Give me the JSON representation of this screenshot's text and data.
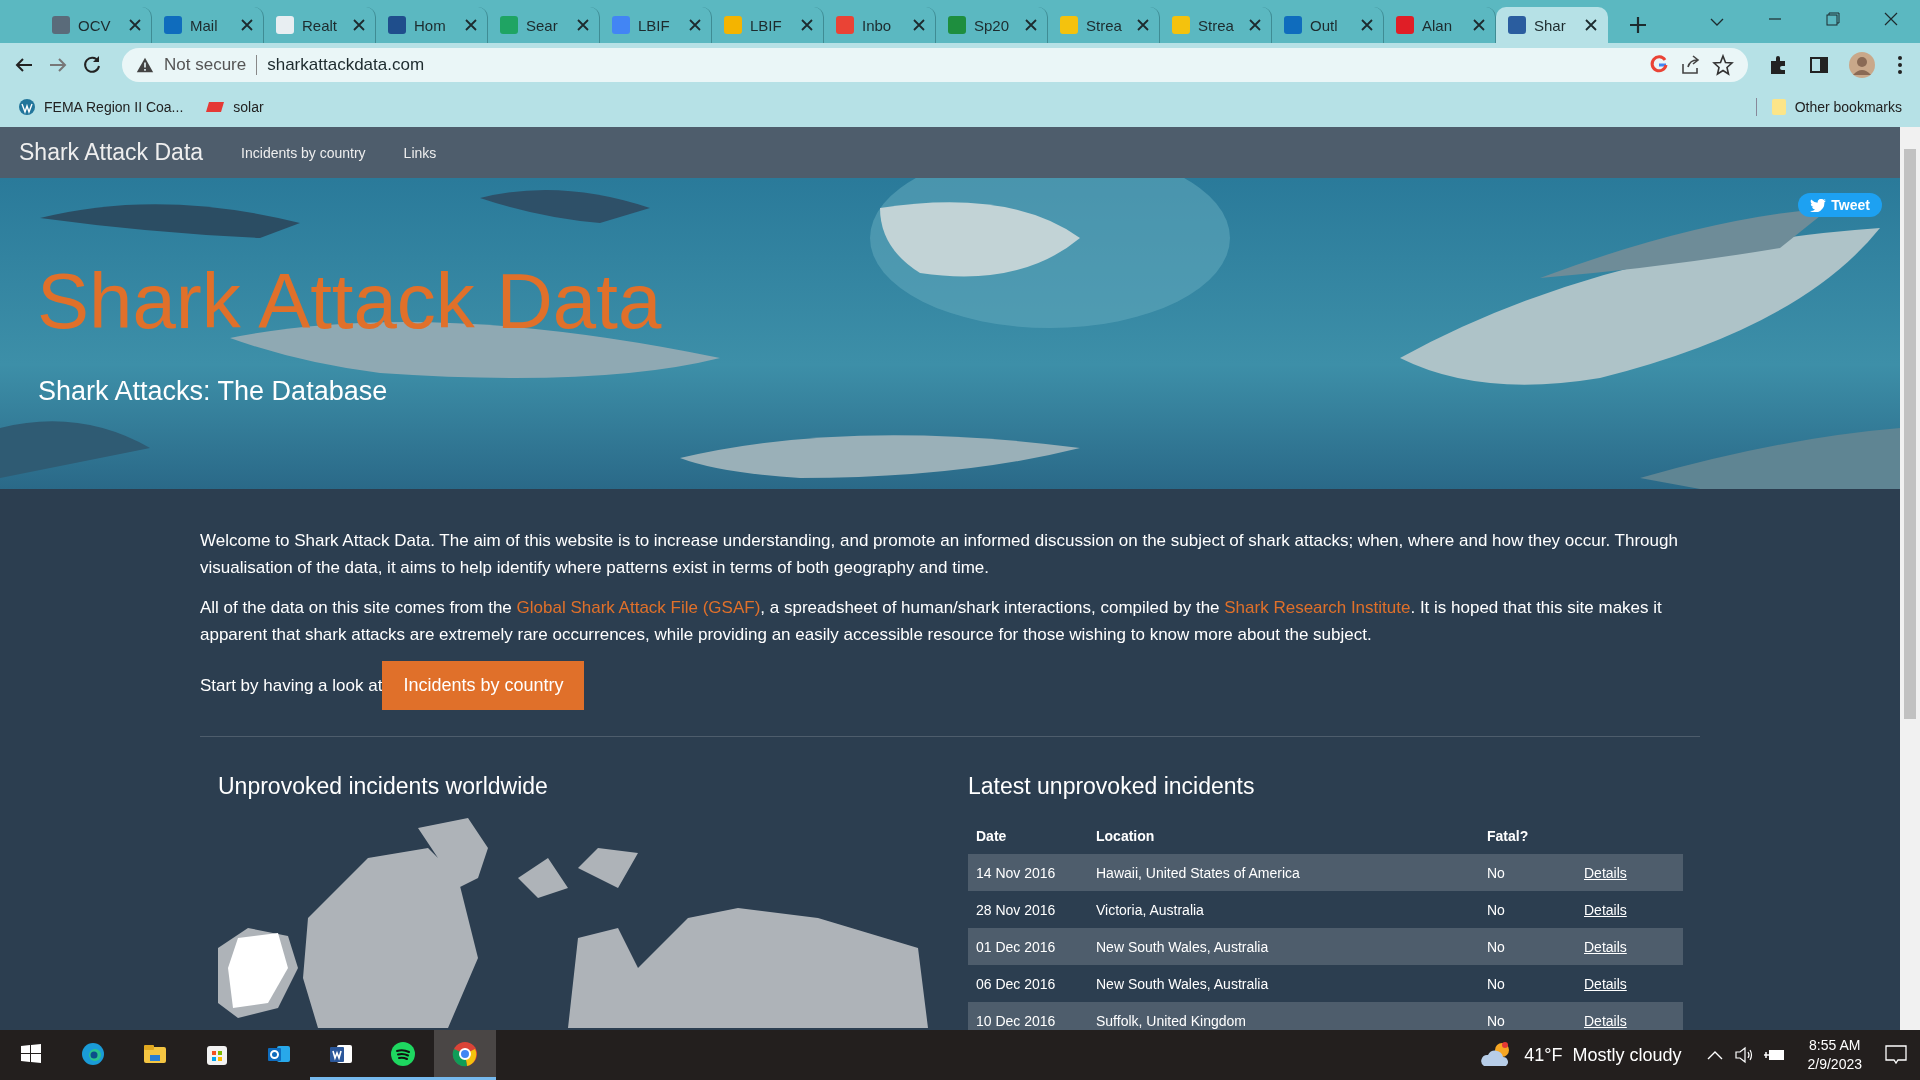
{
  "browser": {
    "tabs": [
      {
        "title": "OCV",
        "color": "#5a6b7a",
        "selected": false
      },
      {
        "title": "Mail",
        "color": "#0f6cbd",
        "selected": false
      },
      {
        "title": "Realt",
        "color": "#e8eef2",
        "selected": false
      },
      {
        "title": "Hom",
        "color": "#1f4e8c",
        "selected": false
      },
      {
        "title": "Sear",
        "color": "#1fa463",
        "selected": false
      },
      {
        "title": "LBIF",
        "color": "#4285f4",
        "selected": false
      },
      {
        "title": "LBIF",
        "color": "#f4b400",
        "selected": false
      },
      {
        "title": "Inbo",
        "color": "#ea4335",
        "selected": false
      },
      {
        "title": "Sp20",
        "color": "#1e8e3e",
        "selected": false
      },
      {
        "title": "Strea",
        "color": "#f4c20d",
        "selected": false
      },
      {
        "title": "Strea",
        "color": "#f4c20d",
        "selected": false
      },
      {
        "title": "Outl",
        "color": "#0f6cbd",
        "selected": false
      },
      {
        "title": "Alan",
        "color": "#e01e26",
        "selected": false
      },
      {
        "title": "Shar",
        "color": "#2a5d9f",
        "selected": true
      }
    ],
    "security": "Not secure",
    "url": "sharkattackdata.com",
    "bookmarks": [
      {
        "label": "FEMA Region II Coa..."
      },
      {
        "label": "solar"
      }
    ],
    "other_bookmarks": "Other bookmarks"
  },
  "site": {
    "brand": "Shark Attack Data",
    "nav": [
      {
        "label": "Incidents by country"
      },
      {
        "label": "Links"
      }
    ],
    "hero": {
      "title": "Shark Attack Data",
      "subtitle": "Shark Attacks: The Database",
      "tweet": "Tweet"
    },
    "paragraphs": [
      [
        {
          "text": "Welcome to Shark Attack Data. The aim of this website is to increase understanding, and promote an informed discussion on the subject of shark attacks; when, where and how they occur. Through visualisation of the data, it aims to help identify where patterns exist in terms of both geography and time."
        }
      ],
      [
        {
          "text": "All of the data on this site comes from the "
        },
        {
          "link": "Global Shark Attack File (GSAF)"
        },
        {
          "text": ", a spreadsheet of human/shark interactions, compiled by the "
        },
        {
          "link": "Shark Research Institute"
        },
        {
          "text": ". It is hoped that this site makes it apparent that shark attacks are extremely rare occurrences, while providing an easily accessible resource for those wishing to know more about the subject."
        }
      ]
    ],
    "start_text": "Start by having a look at",
    "start_button": "Incidents by country",
    "map_title": "Unprovoked incidents worldwide",
    "table": {
      "title": "Latest unprovoked incidents",
      "columns": [
        "Date",
        "Location",
        "Fatal?"
      ],
      "rows": [
        {
          "date": "14 Nov 2016",
          "location": "Hawaii, United States of America",
          "fatal": "No",
          "link": "Details"
        },
        {
          "date": "28 Nov 2016",
          "location": "Victoria, Australia",
          "fatal": "No",
          "link": "Details"
        },
        {
          "date": "01 Dec 2016",
          "location": "New South Wales, Australia",
          "fatal": "No",
          "link": "Details"
        },
        {
          "date": "06 Dec 2016",
          "location": "New South Wales, Australia",
          "fatal": "No",
          "link": "Details"
        },
        {
          "date": "10 Dec 2016",
          "location": "Suffolk, United Kingdom",
          "fatal": "No",
          "link": "Details"
        }
      ]
    }
  },
  "taskbar": {
    "apps": [
      {
        "running": false,
        "selected": false
      },
      {
        "running": false,
        "selected": false
      },
      {
        "running": false,
        "selected": false
      },
      {
        "running": false,
        "selected": false
      },
      {
        "running": true,
        "selected": false
      },
      {
        "running": true,
        "selected": false
      },
      {
        "running": true,
        "selected": true
      }
    ],
    "temperature": "41°F",
    "weather": "Mostly cloudy",
    "time": "8:55 AM",
    "date": "2/9/2023"
  }
}
